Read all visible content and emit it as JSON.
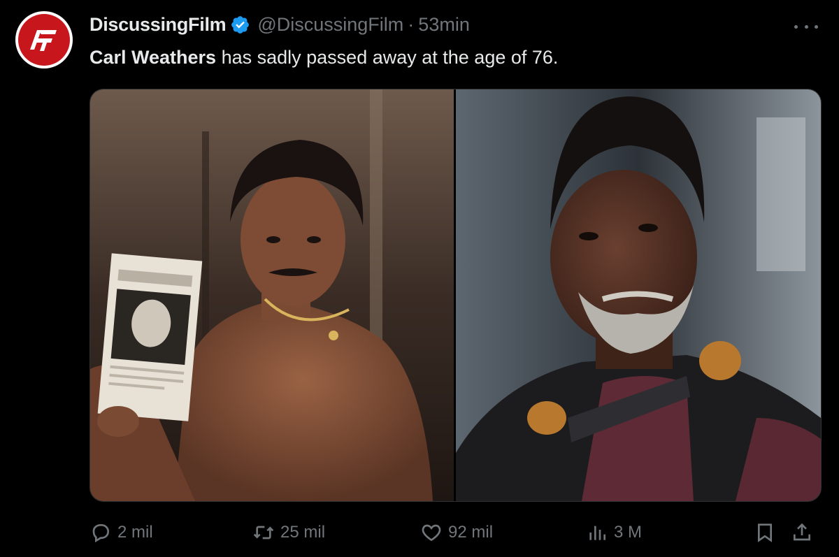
{
  "author": {
    "display_name": "DiscussingFilm",
    "handle": "@DiscussingFilm",
    "separator": "·",
    "time": "53min",
    "avatar_logo_text": "DF"
  },
  "tweet": {
    "name_bold": "Carl Weathers",
    "text_rest": " has sadly passed away at the age of 76."
  },
  "media": {
    "left_image": "photo-young-man-holding-newspaper",
    "right_image": "photo-older-man-grey-beard-costume"
  },
  "actions": {
    "replies": "2 mil",
    "retweets": "25 mil",
    "likes": "92 mil",
    "views": "3 M"
  },
  "colors": {
    "background": "#000000",
    "text_primary": "#e7e9ea",
    "text_secondary": "#71767b",
    "verified_blue": "#1d9bf0",
    "avatar_red": "#c8161d"
  },
  "icons": {
    "reply": "reply-icon",
    "retweet": "retweet-icon",
    "like": "heart-icon",
    "views": "views-chart-icon",
    "bookmark": "bookmark-icon",
    "share": "share-icon",
    "more": "more-options-icon",
    "verified": "verified-badge-icon"
  }
}
